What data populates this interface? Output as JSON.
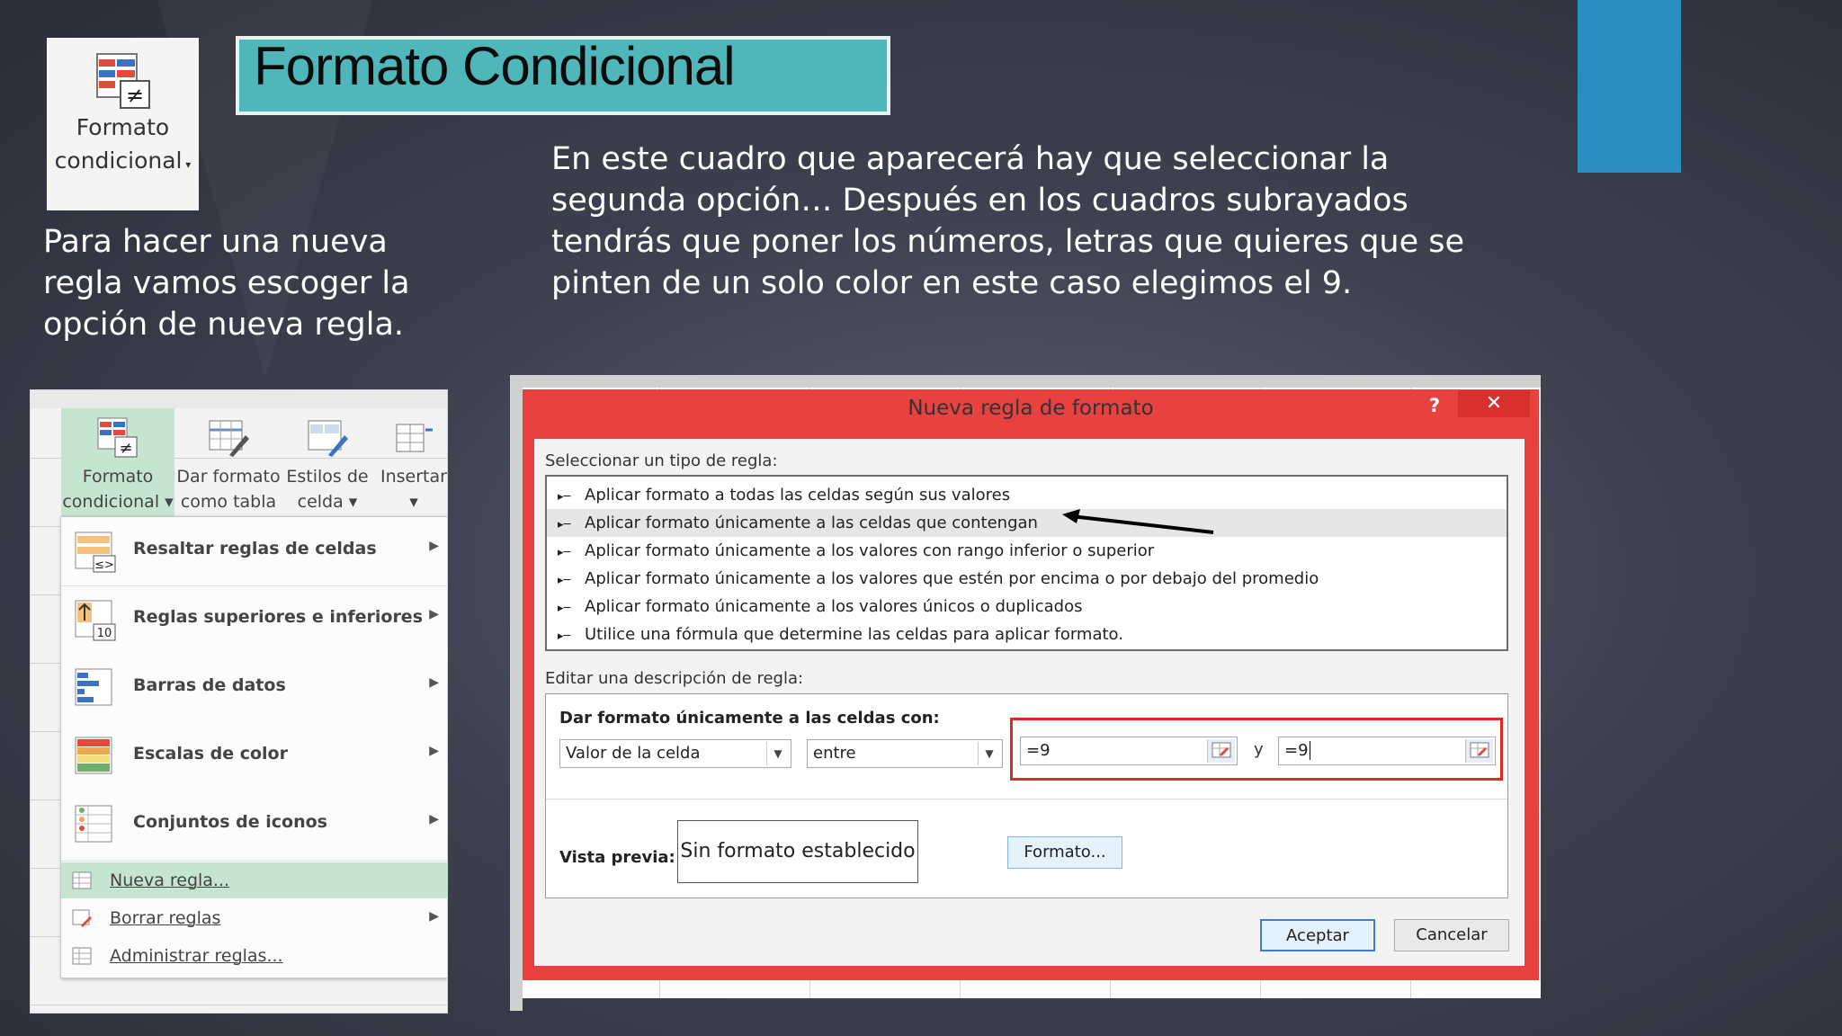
{
  "slide": {
    "title": "Formato Condicional",
    "text_left": "Para hacer una nueva regla vamos escoger la opción de nueva regla.",
    "text_right": "En este cuadro que aparecerá hay que seleccionar la segunda opción… Después en los cuadros subrayados tendrás que poner los números, letras que quieres que se pinten de un solo color en este caso elegimos el 9.",
    "accent_color": "#2a8ec0",
    "title_bg": "#4fb7ba"
  },
  "top_button": {
    "label_line1": "Formato",
    "label_line2": "condicional",
    "icon": "conditional-format-icon"
  },
  "excel": {
    "ribbon": [
      {
        "l1": "Formato",
        "l2": "condicional ▾",
        "icon": "conditional-format-icon"
      },
      {
        "l1": "Dar formato",
        "l2": "como tabla ▾",
        "icon": "format-table-icon"
      },
      {
        "l1": "Estilos de",
        "l2": "celda ▾",
        "icon": "cell-styles-icon"
      },
      {
        "l1": "Insertar",
        "l2": "▾",
        "icon": "insert-icon"
      }
    ],
    "menu_items": [
      {
        "label": "Resaltar reglas de celdas",
        "icon": "highlight-rules-icon"
      },
      {
        "label": "Reglas superiores e inferiores",
        "icon": "top-bottom-rules-icon",
        "badge": "10"
      },
      {
        "label": "Barras de datos",
        "icon": "data-bars-icon"
      },
      {
        "label": "Escalas de color",
        "icon": "color-scales-icon"
      },
      {
        "label": "Conjuntos de iconos",
        "icon": "icon-sets-icon"
      }
    ],
    "sub_items": [
      {
        "label": "Nueva regla...",
        "icon": "new-rule-icon"
      },
      {
        "label": "Borrar reglas",
        "icon": "clear-rules-icon"
      },
      {
        "label": "Administrar reglas...",
        "icon": "manage-rules-icon"
      }
    ]
  },
  "dialog": {
    "title": "Nueva regla de formato",
    "help": "?",
    "close": "✕",
    "select_label": "Seleccionar un tipo de regla:",
    "rules": [
      "Aplicar formato a todas las celdas según sus valores",
      "Aplicar formato únicamente a las celdas que contengan",
      "Aplicar formato únicamente a los valores con rango inferior o superior",
      "Aplicar formato únicamente a los valores que estén por encima o por debajo del promedio",
      "Aplicar formato únicamente a los valores únicos o duplicados",
      "Utilice una fórmula que determine las celdas para aplicar formato."
    ],
    "selected_rule_index": 1,
    "edit_label": "Editar una descripción de regla:",
    "cells_label": "Dar formato únicamente a las celdas con:",
    "combo1": "Valor de la celda",
    "combo2": "entre",
    "value1": "=9",
    "and_label": "y",
    "value2": "=9",
    "preview_label": "Vista previa:",
    "preview_text": "Sin formato establecido",
    "format_button": "Formato...",
    "ok_button": "Aceptar",
    "cancel_button": "Cancelar",
    "highlight_color": "#e12626"
  }
}
